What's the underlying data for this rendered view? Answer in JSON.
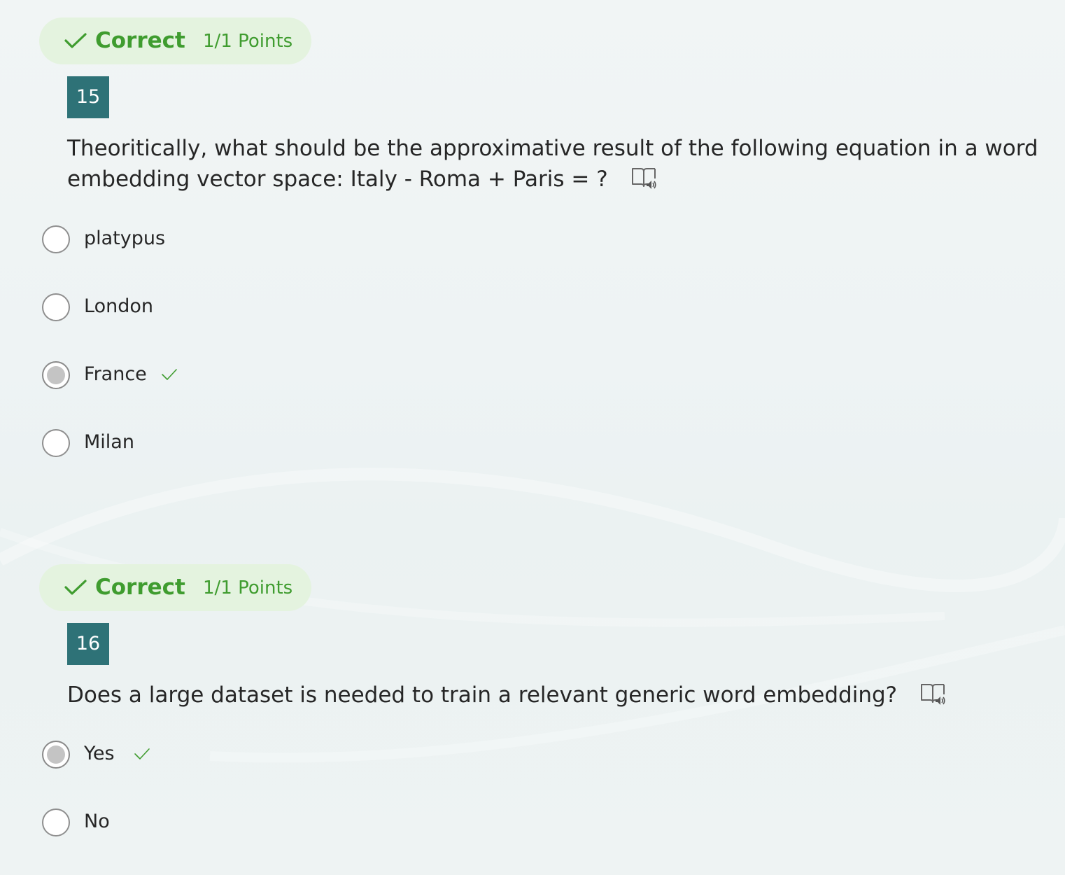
{
  "colors": {
    "correct_green": "#3f9c2f",
    "pill_bg": "#e4f3df",
    "number_badge": "#2e7277"
  },
  "questions": [
    {
      "result": {
        "label": "Correct",
        "points": "1/1 Points",
        "icon": "check-icon"
      },
      "number": "15",
      "text": "Theoritically, what should be the approximative result of the following equation in a word embedding vector space: Italy - Roma + Paris = ?",
      "reader_icon": "immersive-reader-icon",
      "options": [
        {
          "label": "platypus",
          "selected": false,
          "correct": false
        },
        {
          "label": "London",
          "selected": false,
          "correct": false
        },
        {
          "label": "France",
          "selected": true,
          "correct": true
        },
        {
          "label": "Milan",
          "selected": false,
          "correct": false
        }
      ]
    },
    {
      "result": {
        "label": "Correct",
        "points": "1/1 Points",
        "icon": "check-icon"
      },
      "number": "16",
      "text": "Does a large dataset is needed to train a relevant generic word embedding?",
      "reader_icon": "immersive-reader-icon",
      "options": [
        {
          "label": "Yes",
          "selected": true,
          "correct": true
        },
        {
          "label": "No",
          "selected": false,
          "correct": false
        }
      ]
    }
  ]
}
